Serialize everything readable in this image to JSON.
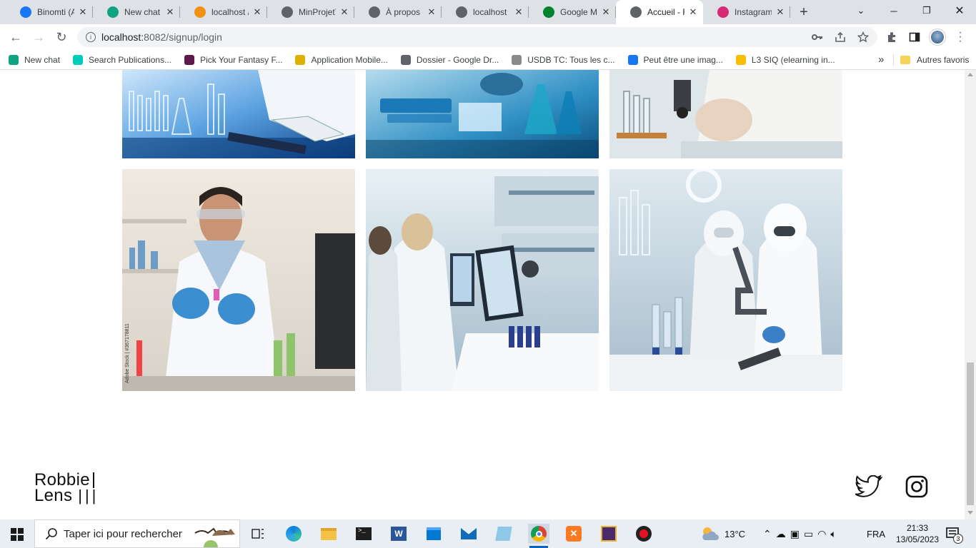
{
  "browser": {
    "tabs": [
      {
        "title": "Binomti (A",
        "icon": "facebook-icon",
        "color": "#1877f2"
      },
      {
        "title": "New chat",
        "icon": "chatgpt-icon",
        "color": "#10a37f"
      },
      {
        "title": "localhost /",
        "icon": "phpmyadmin-icon",
        "color": "#f29111"
      },
      {
        "title": "MinProjetT",
        "icon": "globe-icon",
        "color": "#5f6368"
      },
      {
        "title": "À propos -",
        "icon": "globe-icon",
        "color": "#5f6368"
      },
      {
        "title": "localhost",
        "icon": "globe-icon",
        "color": "#5f6368"
      },
      {
        "title": "Google Me",
        "icon": "google-meet-icon",
        "color": "#00832d"
      },
      {
        "title": "Accueil - R",
        "icon": "globe-icon",
        "color": "#5f6368",
        "active": true
      },
      {
        "title": "Instagram",
        "icon": "instagram-icon",
        "color": "#d62976"
      }
    ],
    "url_host": "localhost:",
    "url_path": "8082/signup/login",
    "bookmarks": [
      {
        "label": "New chat",
        "icon": "chatgpt-icon",
        "color": "#10a37f"
      },
      {
        "label": "Search Publications...",
        "icon": "researchgate-icon",
        "color": "#00ccbb"
      },
      {
        "label": "Pick Your Fantasy F...",
        "icon": "mask-icon",
        "color": "#5b1a4a"
      },
      {
        "label": "Application Mobile...",
        "icon": "folder-image-icon",
        "color": "#e0b000"
      },
      {
        "label": "Dossier - Google Dr...",
        "icon": "globe-icon",
        "color": "#5f6368"
      },
      {
        "label": "USDB TC: Tous les c...",
        "icon": "moodle-icon",
        "color": "#8a8a8a"
      },
      {
        "label": "Peut être une imag...",
        "icon": "facebook-icon",
        "color": "#1877f2"
      },
      {
        "label": "L3 SIQ (elearning in...",
        "icon": "google-drive-icon",
        "color": "#fbbc04"
      }
    ],
    "overflow": "»",
    "other_favorites": "Autres favoris"
  },
  "page": {
    "logo_line1": "Robbie",
    "logo_line2": "Lens",
    "social": [
      "twitter-icon",
      "instagram-icon"
    ]
  },
  "taskbar": {
    "search_placeholder": "Taper ici pour rechercher",
    "weather": "13°C",
    "language": "FRA",
    "time": "21:33",
    "date": "13/05/2023",
    "notifications": "3"
  }
}
